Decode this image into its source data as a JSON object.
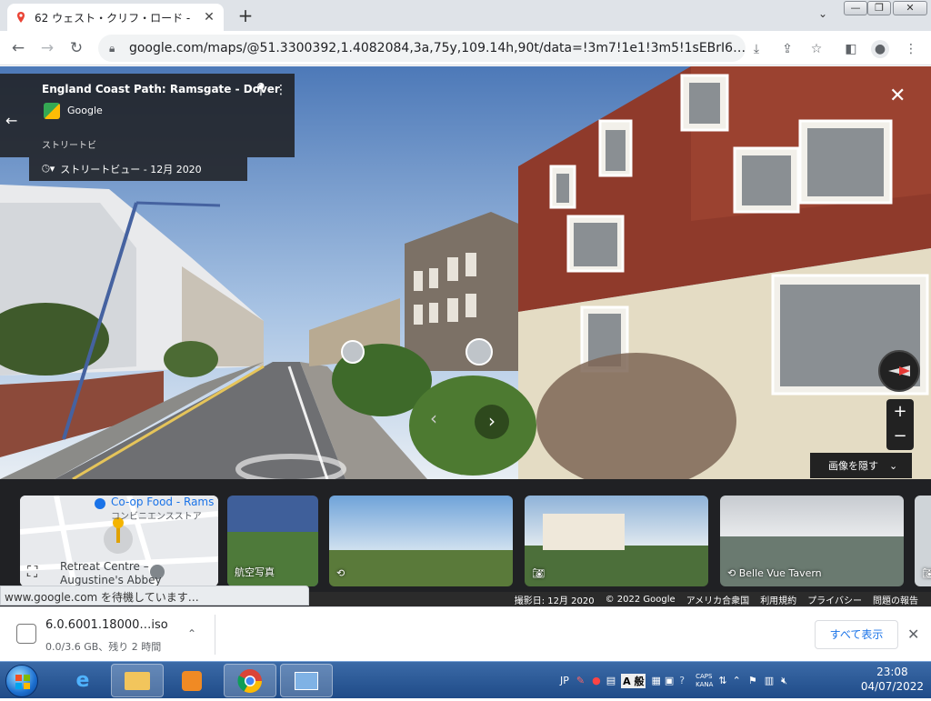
{
  "browser": {
    "tab_title": "62 ウェスト・クリフ・ロード - ",
    "tab_close": "✕",
    "new_tab": "+",
    "url": "google.com/maps/@51.3300392,1.4082084,3a,75y,109.14h,90t/data=!3m7!1e1!3m5!1sEBrI6…",
    "window_controls": [
      "—",
      "❐",
      "✕"
    ]
  },
  "streetview": {
    "place_title": "England Coast Path: Ramsgate - Dover",
    "provider": "Google",
    "sv_label": "ストリートビ",
    "date_label": "ストリートビュー - 12月 2020",
    "hide_images": "画像を隠す",
    "zoom_in": "+",
    "zoom_out": "−"
  },
  "thumbnails": [
    {
      "caption": "",
      "map_place": "Co-op Food - Rams",
      "map_sub": "コンビニエンスストア",
      "map_place2": "Retreat Centre –",
      "map_place3": "Augustine's Abbey"
    },
    {
      "caption": "航空写真"
    },
    {
      "caption": ""
    },
    {
      "caption": ""
    },
    {
      "caption": "Belle Vue Tavern"
    }
  ],
  "footer": {
    "items": [
      "撮影日: 12月 2020",
      "© 2022 Google",
      "アメリカ合衆国",
      "利用規約",
      "プライバシー",
      "問題の報告"
    ]
  },
  "status_text": "www.google.com を待機しています…",
  "download": {
    "filename": "6.0.6001.18000…iso",
    "status": "0.0/3.6 GB、残り 2 時間",
    "show_all": "すべて表示"
  },
  "taskbar": {
    "lang": "JP",
    "caps": "CAPS",
    "kana": "KANA",
    "ime_mode": "般",
    "time": "23:08",
    "date": "04/07/2022"
  }
}
